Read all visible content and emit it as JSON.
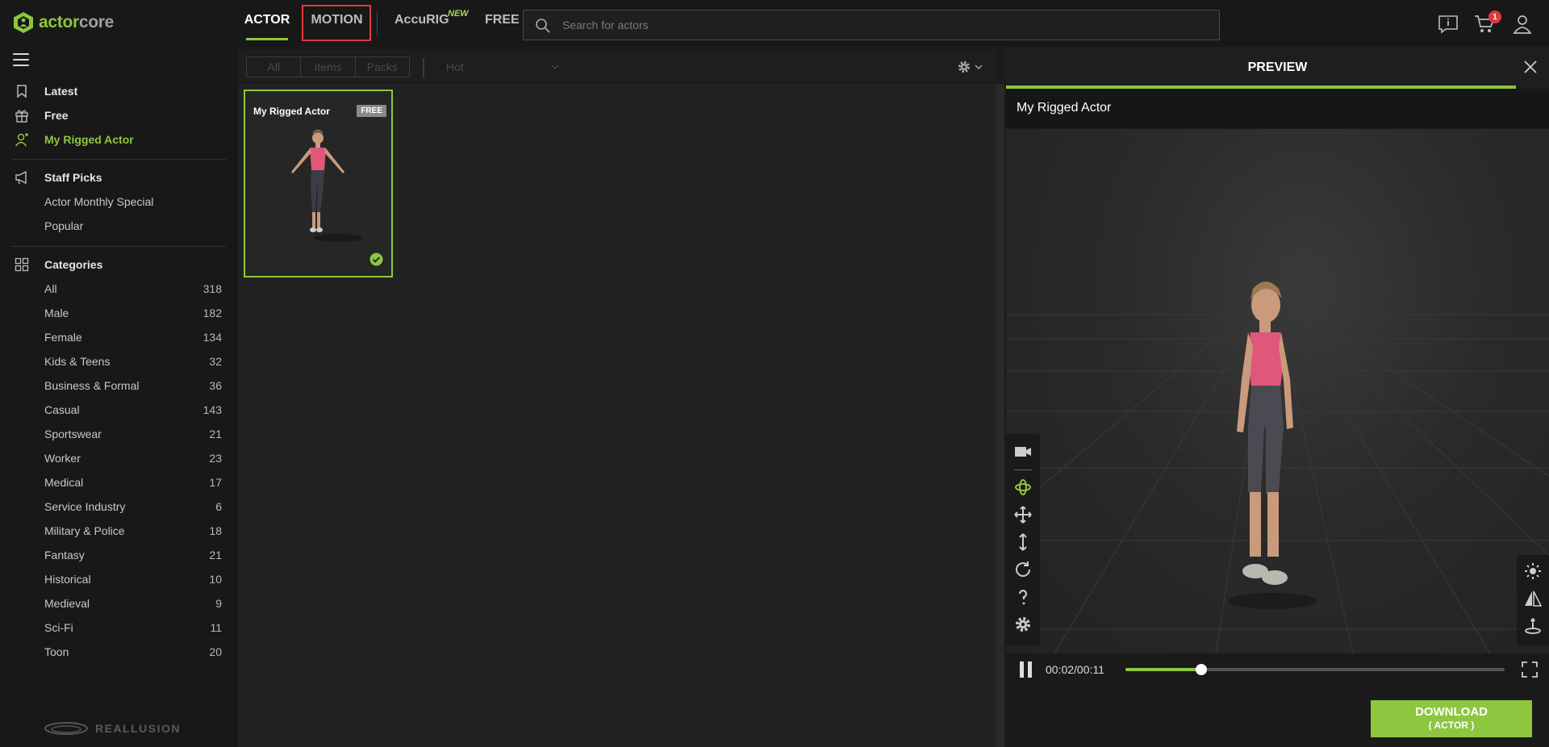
{
  "brand": {
    "logo_part1": "actor",
    "logo_part2": "core",
    "footer": "REALLUSION"
  },
  "colors": {
    "accent": "#8dc63f",
    "highlight_box": "#e03a3a",
    "badge": "#e03a3a"
  },
  "sidebar": {
    "top_items": [
      {
        "label": "Latest",
        "icon": "bookmark-icon"
      },
      {
        "label": "Free",
        "icon": "gift-icon"
      },
      {
        "label": "My Rigged Actor",
        "icon": "add-user-icon",
        "active": true
      }
    ],
    "staff_picks": {
      "label": "Staff Picks",
      "icon": "megaphone-icon",
      "items": [
        "Actor Monthly Special",
        "Popular"
      ]
    },
    "categories": {
      "label": "Categories",
      "icon": "grid-icon",
      "items": [
        {
          "label": "All",
          "count": "318"
        },
        {
          "label": "Male",
          "count": "182"
        },
        {
          "label": "Female",
          "count": "134"
        },
        {
          "label": "Kids & Teens",
          "count": "32"
        },
        {
          "label": "Business & Formal",
          "count": "36"
        },
        {
          "label": "Casual",
          "count": "143"
        },
        {
          "label": "Sportswear",
          "count": "21"
        },
        {
          "label": "Worker",
          "count": "23"
        },
        {
          "label": "Medical",
          "count": "17"
        },
        {
          "label": "Service Industry",
          "count": "6"
        },
        {
          "label": "Military & Police",
          "count": "18"
        },
        {
          "label": "Fantasy",
          "count": "21"
        },
        {
          "label": "Historical",
          "count": "10"
        },
        {
          "label": "Medieval",
          "count": "9"
        },
        {
          "label": "Sci-Fi",
          "count": "11"
        },
        {
          "label": "Toon",
          "count": "20"
        }
      ]
    }
  },
  "topbar": {
    "tabs": {
      "actor": "ACTOR",
      "motion": "MOTION",
      "accurig": "AccuRIG",
      "free": "FREE"
    },
    "new_badge": "NEW",
    "search_placeholder": "Search for actors",
    "cart_count": "1"
  },
  "filterbar": {
    "segments": [
      "All",
      "Items",
      "Packs"
    ],
    "sort_value": "Hot"
  },
  "grid": {
    "cards": [
      {
        "title": "My Rigged Actor",
        "badge": "FREE",
        "selected": true
      }
    ]
  },
  "preview": {
    "header": "PREVIEW",
    "actor_name": "My Rigged Actor",
    "time": "00:02/00:11",
    "progress": 0.2,
    "download_line1": "DOWNLOAD",
    "download_line2": "( ACTOR )"
  }
}
